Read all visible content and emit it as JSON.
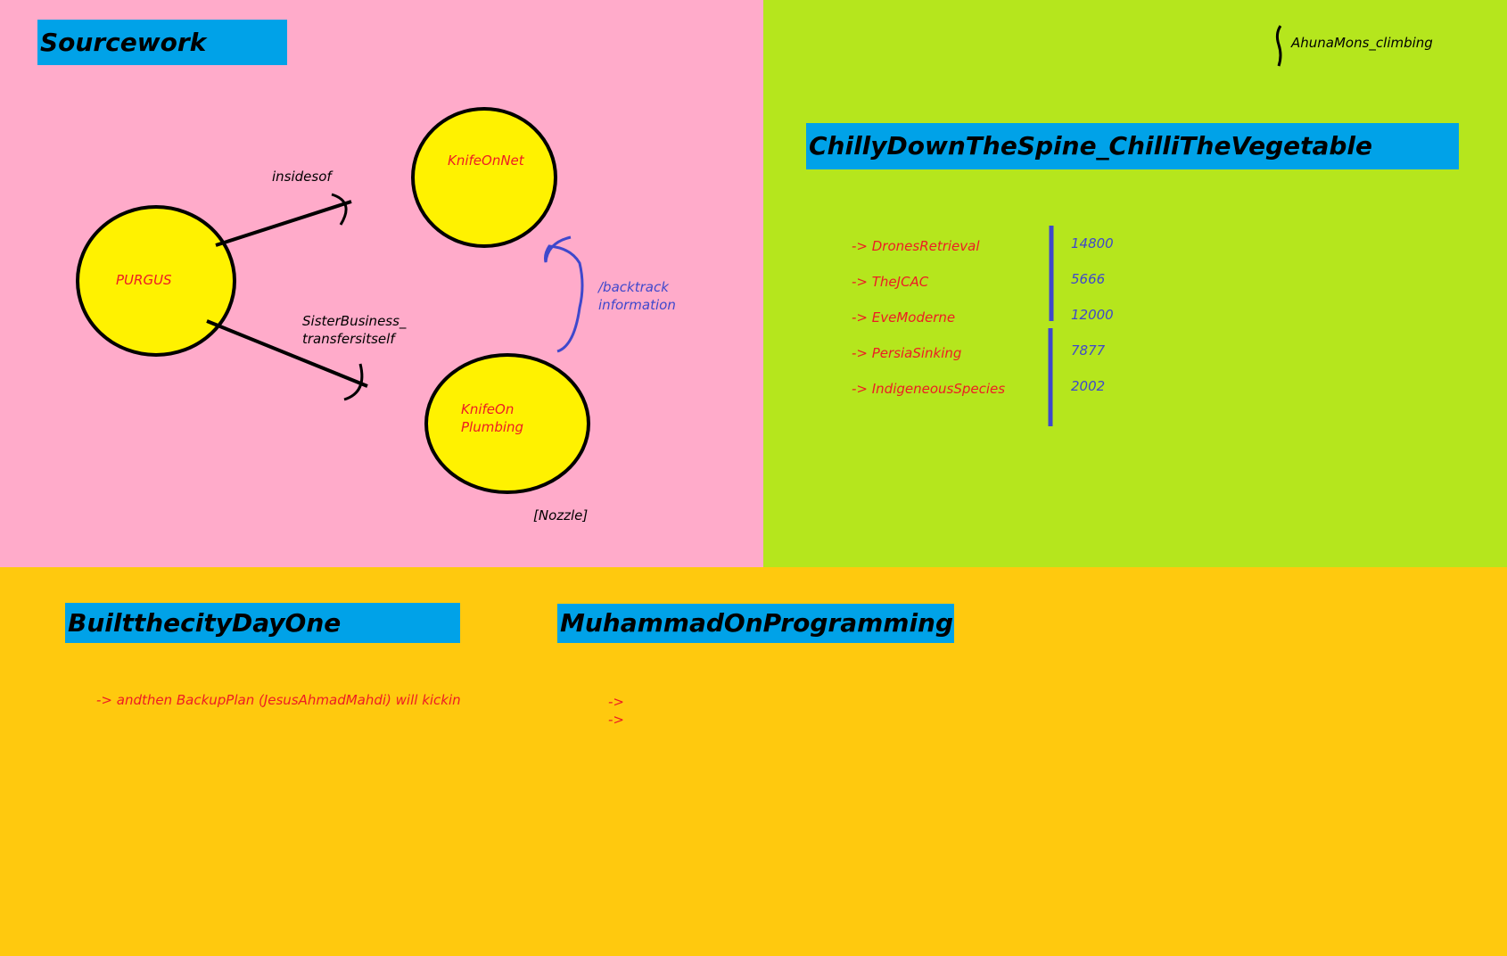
{
  "sourcework": {
    "title": "Sourcework",
    "nodes": {
      "purgus": "PURGUS",
      "knife_on_net": "KnifeOnNet",
      "knife_on_plumbing_line1": "KnifeOn",
      "knife_on_plumbing_line2": "Plumbing"
    },
    "edges": {
      "insidesof": "insidesof",
      "sister_line1": "SisterBusiness_",
      "sister_line2": "transfersitself",
      "backtrack_line1": "/backtrack",
      "backtrack_line2": "information"
    },
    "nozzle": "[Nozzle]"
  },
  "chilly": {
    "corner_label": "AhunaMons_climbing",
    "title": "ChillyDownTheSpine_ChilliTheVegetable",
    "items": [
      {
        "label": "-> DronesRetrieval",
        "value": "14800"
      },
      {
        "label": "-> TheJCAC",
        "value": "5666"
      },
      {
        "label": "-> EveModerne",
        "value": "12000"
      },
      {
        "label": "-> PersiaSinking",
        "value": "7877"
      },
      {
        "label": "-> IndigeneousSpecies",
        "value": "2002"
      }
    ]
  },
  "builtthecity": {
    "title": "BuiltthecityDayOne",
    "line": "-> andthen BackupPlan (JesusAhmadMahdi) will kickin"
  },
  "muhammad": {
    "title": "MuhammadOnProgramming",
    "bullets": [
      "->",
      "->"
    ]
  },
  "colors": {
    "pink": "#ffabca",
    "green": "#b5e61d",
    "yellow": "#ffc90e",
    "title_blue": "#00a2e8",
    "node_yellow": "#fff200",
    "text_red": "#ed1c24",
    "text_blue": "#3f48cc"
  }
}
